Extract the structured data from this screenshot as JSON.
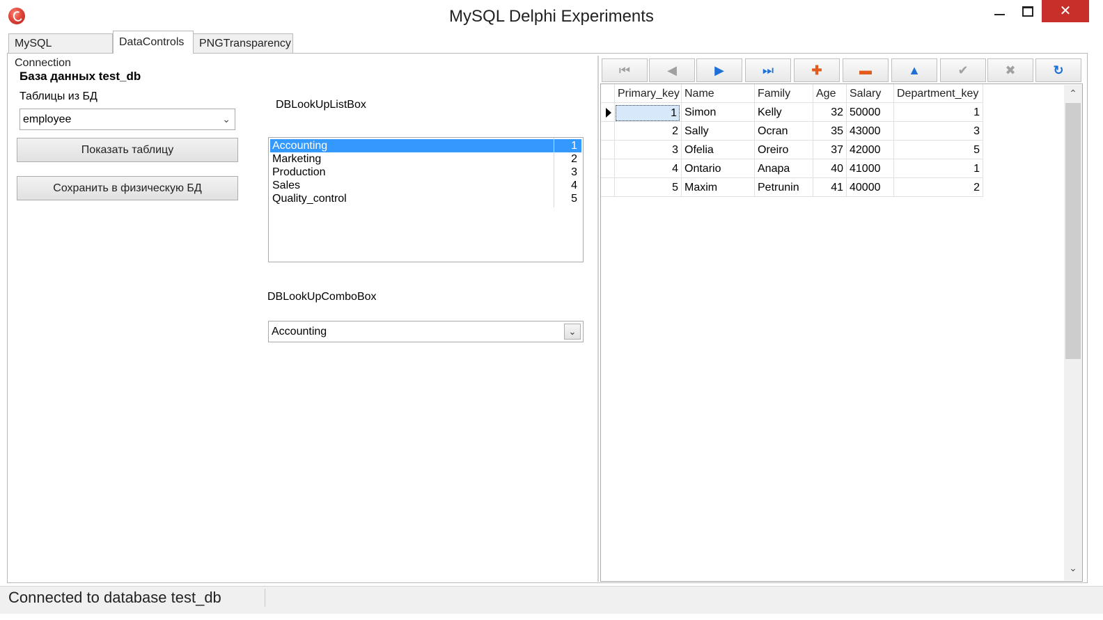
{
  "window": {
    "title": "MySQL Delphi Experiments",
    "close_glyph": "✕"
  },
  "tabs": [
    {
      "label": "MySQL Connection",
      "active": false
    },
    {
      "label": "DataControls",
      "active": true
    },
    {
      "label": "PNGTransparency",
      "active": false
    }
  ],
  "left_panel": {
    "heading": "База данных test_db",
    "tables_label": "Таблицы из БД",
    "table_select_value": "employee",
    "show_table_button": "Показать таблицу",
    "save_button": "Сохранить в физическую БД"
  },
  "listbox": {
    "label": "DBLookUpListBox",
    "items": [
      {
        "name": "Accounting",
        "key": "1",
        "selected": true
      },
      {
        "name": "Marketing",
        "key": "2",
        "selected": false
      },
      {
        "name": "Production",
        "key": "3",
        "selected": false
      },
      {
        "name": "Sales",
        "key": "4",
        "selected": false
      },
      {
        "name": "Quality_control",
        "key": "5",
        "selected": false
      }
    ]
  },
  "combobox": {
    "label": "DBLookUpComboBox",
    "value": "Accounting"
  },
  "navigator": {
    "buttons": [
      {
        "id": "first",
        "icon": "first-record-icon",
        "glyph": "⏮"
      },
      {
        "id": "prior",
        "icon": "prior-record-icon",
        "glyph": "◀"
      },
      {
        "id": "next",
        "icon": "next-record-icon",
        "glyph": "▶"
      },
      {
        "id": "last",
        "icon": "last-record-icon",
        "glyph": "⏭"
      },
      {
        "id": "insert",
        "icon": "insert-record-icon",
        "glyph": "✚"
      },
      {
        "id": "delete",
        "icon": "delete-record-icon",
        "glyph": "▬"
      },
      {
        "id": "edit",
        "icon": "edit-record-icon",
        "glyph": "▲"
      },
      {
        "id": "post",
        "icon": "post-record-icon",
        "glyph": "✔"
      },
      {
        "id": "cancel",
        "icon": "cancel-record-icon",
        "glyph": "✖"
      },
      {
        "id": "refresh",
        "icon": "refresh-icon",
        "glyph": "↻"
      }
    ]
  },
  "grid": {
    "columns": [
      "Primary_key",
      "Name",
      "Family",
      "Age",
      "Salary",
      "Department_key"
    ],
    "rows": [
      [
        "1",
        "Simon",
        "Kelly",
        "32",
        "50000",
        "1"
      ],
      [
        "2",
        "Sally",
        "Ocran",
        "35",
        "43000",
        "3"
      ],
      [
        "3",
        "Ofelia",
        "Oreiro",
        "37",
        "42000",
        "5"
      ],
      [
        "4",
        "Ontario",
        "Anapa",
        "40",
        "41000",
        "1"
      ],
      [
        "5",
        "Maxim",
        "Petrunin",
        "41",
        "40000",
        "2"
      ]
    ],
    "current_row": 0
  },
  "status": {
    "text": "Connected to database test_db"
  },
  "colors": {
    "selection": "#3399ff",
    "close_button": "#c7302a",
    "nav_blue": "#1e6fd6",
    "nav_orange": "#e25a1c"
  }
}
